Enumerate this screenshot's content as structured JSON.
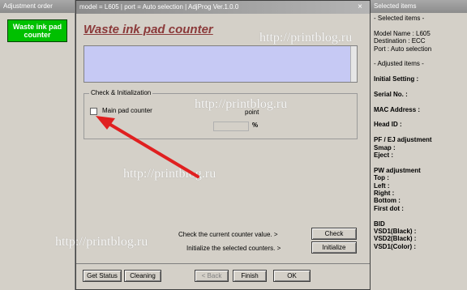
{
  "left_panel": {
    "title": "Adjustment order",
    "item_label": "Waste ink pad counter",
    "item_color": "#00c000"
  },
  "dialog": {
    "title": "model = L605 | port = Auto selection | AdjProg Ver.1.0.0",
    "close_icon": "×",
    "heading": "Waste ink pad counter",
    "heading_color": "#8b3a3a",
    "info_box_color": "#c6c9f4",
    "group_label": "Check & Initialization",
    "checkbox_label": "Main pad counter",
    "point_label": "point",
    "percent_label": "%",
    "check_text": "Check the current counter value.  >",
    "check_button": "Check",
    "init_text": "Initialize the selected counters.  >",
    "init_button": "Initialize",
    "buttons": {
      "get_status": "Get Status",
      "cleaning": "Cleaning",
      "back": "< Back",
      "finish": "Finish",
      "ok": "OK"
    }
  },
  "right_panel": {
    "title": "Selected items",
    "lines": [
      {
        "text": "- Selected items -",
        "bold": false
      },
      {
        "text": "",
        "bold": false
      },
      {
        "text": "Model Name : L605",
        "bold": false
      },
      {
        "text": "Destination : ECC",
        "bold": false
      },
      {
        "text": "Port : Auto selection",
        "bold": false
      },
      {
        "text": "",
        "bold": false
      },
      {
        "text": "- Adjusted items -",
        "bold": false
      },
      {
        "text": "",
        "bold": false
      },
      {
        "text": "Initial Setting :",
        "bold": true
      },
      {
        "text": "",
        "bold": false
      },
      {
        "text": "Serial No. :",
        "bold": true
      },
      {
        "text": "",
        "bold": false
      },
      {
        "text": "MAC Address :",
        "bold": true
      },
      {
        "text": "",
        "bold": false
      },
      {
        "text": "Head ID :",
        "bold": true
      },
      {
        "text": "",
        "bold": false
      },
      {
        "text": "PF / EJ adjustment",
        "bold": true
      },
      {
        "text": "Smap :",
        "bold": true
      },
      {
        "text": "Eject :",
        "bold": true
      },
      {
        "text": "",
        "bold": false
      },
      {
        "text": "PW adjustment",
        "bold": true
      },
      {
        "text": "Top :",
        "bold": true
      },
      {
        "text": "Left :",
        "bold": true
      },
      {
        "text": "Right :",
        "bold": true
      },
      {
        "text": "Bottom :",
        "bold": true
      },
      {
        "text": "First dot :",
        "bold": true
      },
      {
        "text": "",
        "bold": false
      },
      {
        "text": "BID",
        "bold": true
      },
      {
        "text": "VSD1(Black) :",
        "bold": true
      },
      {
        "text": "VSD2(Black) :",
        "bold": true
      },
      {
        "text": "VSD1(Color) :",
        "bold": true
      }
    ]
  },
  "watermarks": [
    "http://printblog.ru",
    "http://printblog.ru",
    "http://printblog.ru",
    "http://printblog.ru"
  ],
  "arrow_color": "#e02020"
}
